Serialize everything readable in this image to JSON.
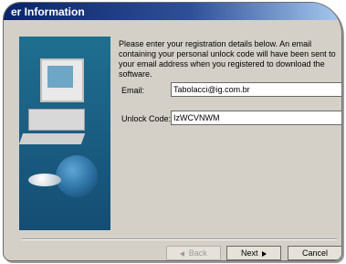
{
  "window": {
    "title": "er Information"
  },
  "instructions": "Please enter your registration details below. An email containing your personal unlock code will have been sent to your email address when you registered to download the software.",
  "email": {
    "label": "Email:",
    "value": "Tabolacci@ig.com.br"
  },
  "unlock": {
    "label": "Unlock Code:",
    "value": "IzWCVNWM"
  },
  "buttons": {
    "back": "Back",
    "next": "Next",
    "cancel": "Cancel"
  },
  "colors": {
    "titlebar_start": "#0a246a",
    "titlebar_end": "#a6caf0",
    "dialog_bg": "#d4d0c8",
    "art_bg": "#1b5f84"
  },
  "icons": [
    "computer-illustration",
    "globe-icon",
    "disc-icon",
    "chevron-left-icon",
    "chevron-right-icon"
  ]
}
